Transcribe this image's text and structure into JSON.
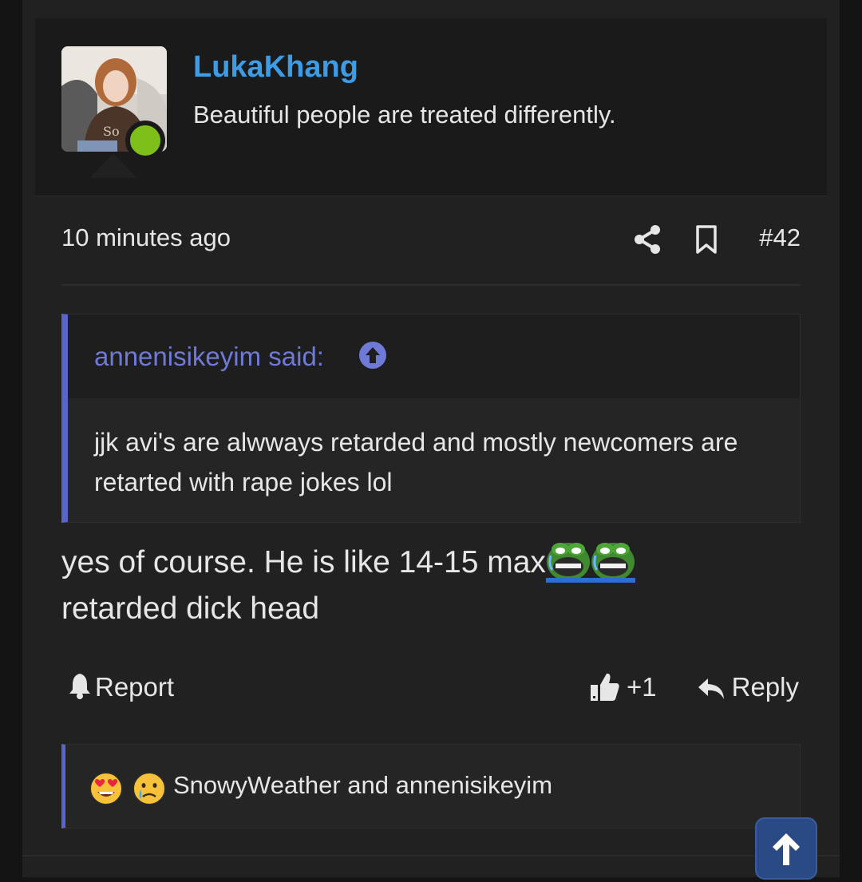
{
  "post": {
    "author": {
      "username": "LukaKhang",
      "user_title": "Beautiful people are treated differently.",
      "online": true
    },
    "timestamp": "10 minutes ago",
    "post_number": "#42",
    "quote": {
      "author_label": "annenisikeyim said:",
      "text": "jjk avi's are alwways retarded and mostly newcomers are retarted with rape jokes lol"
    },
    "message": {
      "line1": "yes of course. He is like 14-15 max",
      "line2": "retarded dick head",
      "smilies": [
        "pepe-laugh-crying",
        "pepe-laugh-crying"
      ]
    },
    "actions": {
      "report_label": "Report",
      "like_count": "+1",
      "reply_label": "Reply"
    },
    "reactions": {
      "emojis": [
        "heart-eyes-emoji",
        "crying-face-emoji"
      ],
      "text": "SnowyWeather and annenisikeyim"
    }
  },
  "colors": {
    "username": "#3d9ce6",
    "quote_accent": "#5a65c9",
    "online": "#7fbf1a",
    "scroll_button": "#2a4a86"
  }
}
